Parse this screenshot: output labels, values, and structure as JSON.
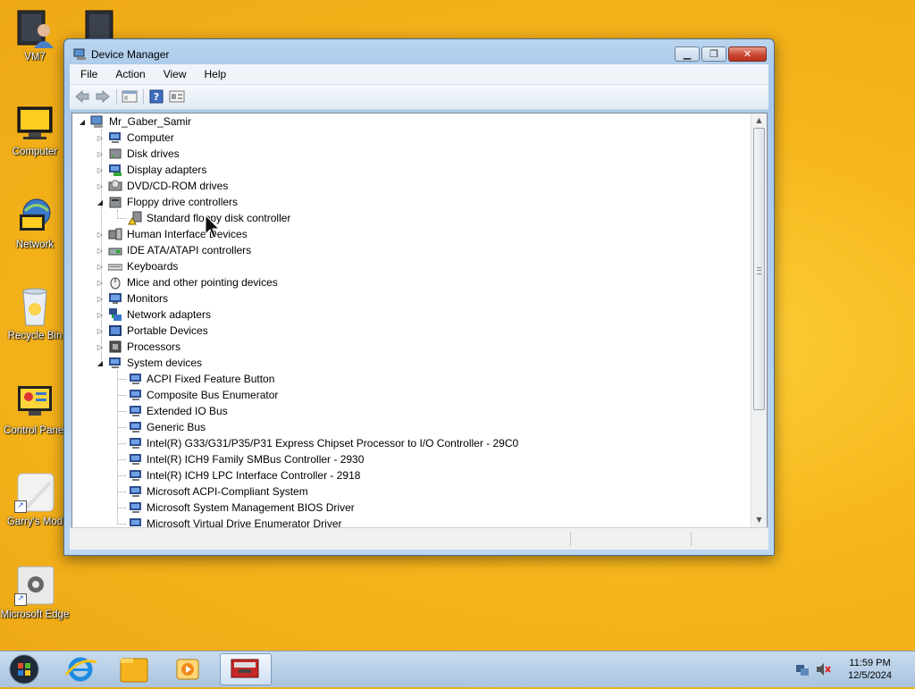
{
  "desktop": {
    "icons": [
      {
        "label": "VM7",
        "icon": "user-folder-icon"
      },
      {
        "label": "",
        "icon": "folder-icon"
      },
      {
        "label": "Computer",
        "icon": "computer-icon"
      },
      {
        "label": "Network",
        "icon": "network-icon"
      },
      {
        "label": "Recycle Bin",
        "icon": "recycle-bin-icon"
      },
      {
        "label": "Control Panel",
        "icon": "control-panel-icon"
      },
      {
        "label": "Garry's Mod",
        "icon": "garrys-mod-icon"
      },
      {
        "label": "Microsoft Edge",
        "icon": "microsoft-edge-icon"
      }
    ]
  },
  "window": {
    "title": "Device Manager",
    "menu": [
      "File",
      "Action",
      "View",
      "Help"
    ],
    "toolbar_icons": [
      "back-icon",
      "forward-icon",
      "properties-icon",
      "help-icon",
      "view-icon"
    ]
  },
  "tree": {
    "root": "Mr_Gaber_Samir",
    "categories": [
      {
        "label": "Computer",
        "expanded": false
      },
      {
        "label": "Disk drives",
        "expanded": false
      },
      {
        "label": "Display adapters",
        "expanded": false
      },
      {
        "label": "DVD/CD-ROM drives",
        "expanded": false
      },
      {
        "label": "Floppy drive controllers",
        "expanded": true
      },
      {
        "label": "Human Interface Devices",
        "expanded": false
      },
      {
        "label": "IDE ATA/ATAPI controllers",
        "expanded": false
      },
      {
        "label": "Keyboards",
        "expanded": false
      },
      {
        "label": "Mice and other pointing devices",
        "expanded": false
      },
      {
        "label": "Monitors",
        "expanded": false
      },
      {
        "label": "Network adapters",
        "expanded": false
      },
      {
        "label": "Portable Devices",
        "expanded": false
      },
      {
        "label": "Processors",
        "expanded": false
      },
      {
        "label": "System devices",
        "expanded": true
      }
    ],
    "floppy_children": [
      "Standard floppy disk controller"
    ],
    "system_children": [
      "ACPI Fixed Feature Button",
      "Composite Bus Enumerator",
      "Extended IO Bus",
      "Generic Bus",
      "Intel(R) G33/G31/P35/P31 Express Chipset Processor to I/O Controller - 29C0",
      "Intel(R) ICH9 Family SMBus Controller - 2930",
      "Intel(R) ICH9 LPC Interface Controller - 2918",
      "Microsoft ACPI-Compliant System",
      "Microsoft System Management BIOS Driver",
      "Microsoft Virtual Drive Enumerator Driver"
    ]
  },
  "taskbar": {
    "items": [
      "start-orb-icon",
      "internet-explorer-icon",
      "file-explorer-icon",
      "media-player-icon",
      "device-manager-task-icon"
    ],
    "time": "11:59 PM",
    "date": "12/5/2024"
  },
  "colors": {
    "desktop": "#f6b61c",
    "taskbar": "#b9d0e8",
    "window_frame": "#a9c8ea"
  }
}
